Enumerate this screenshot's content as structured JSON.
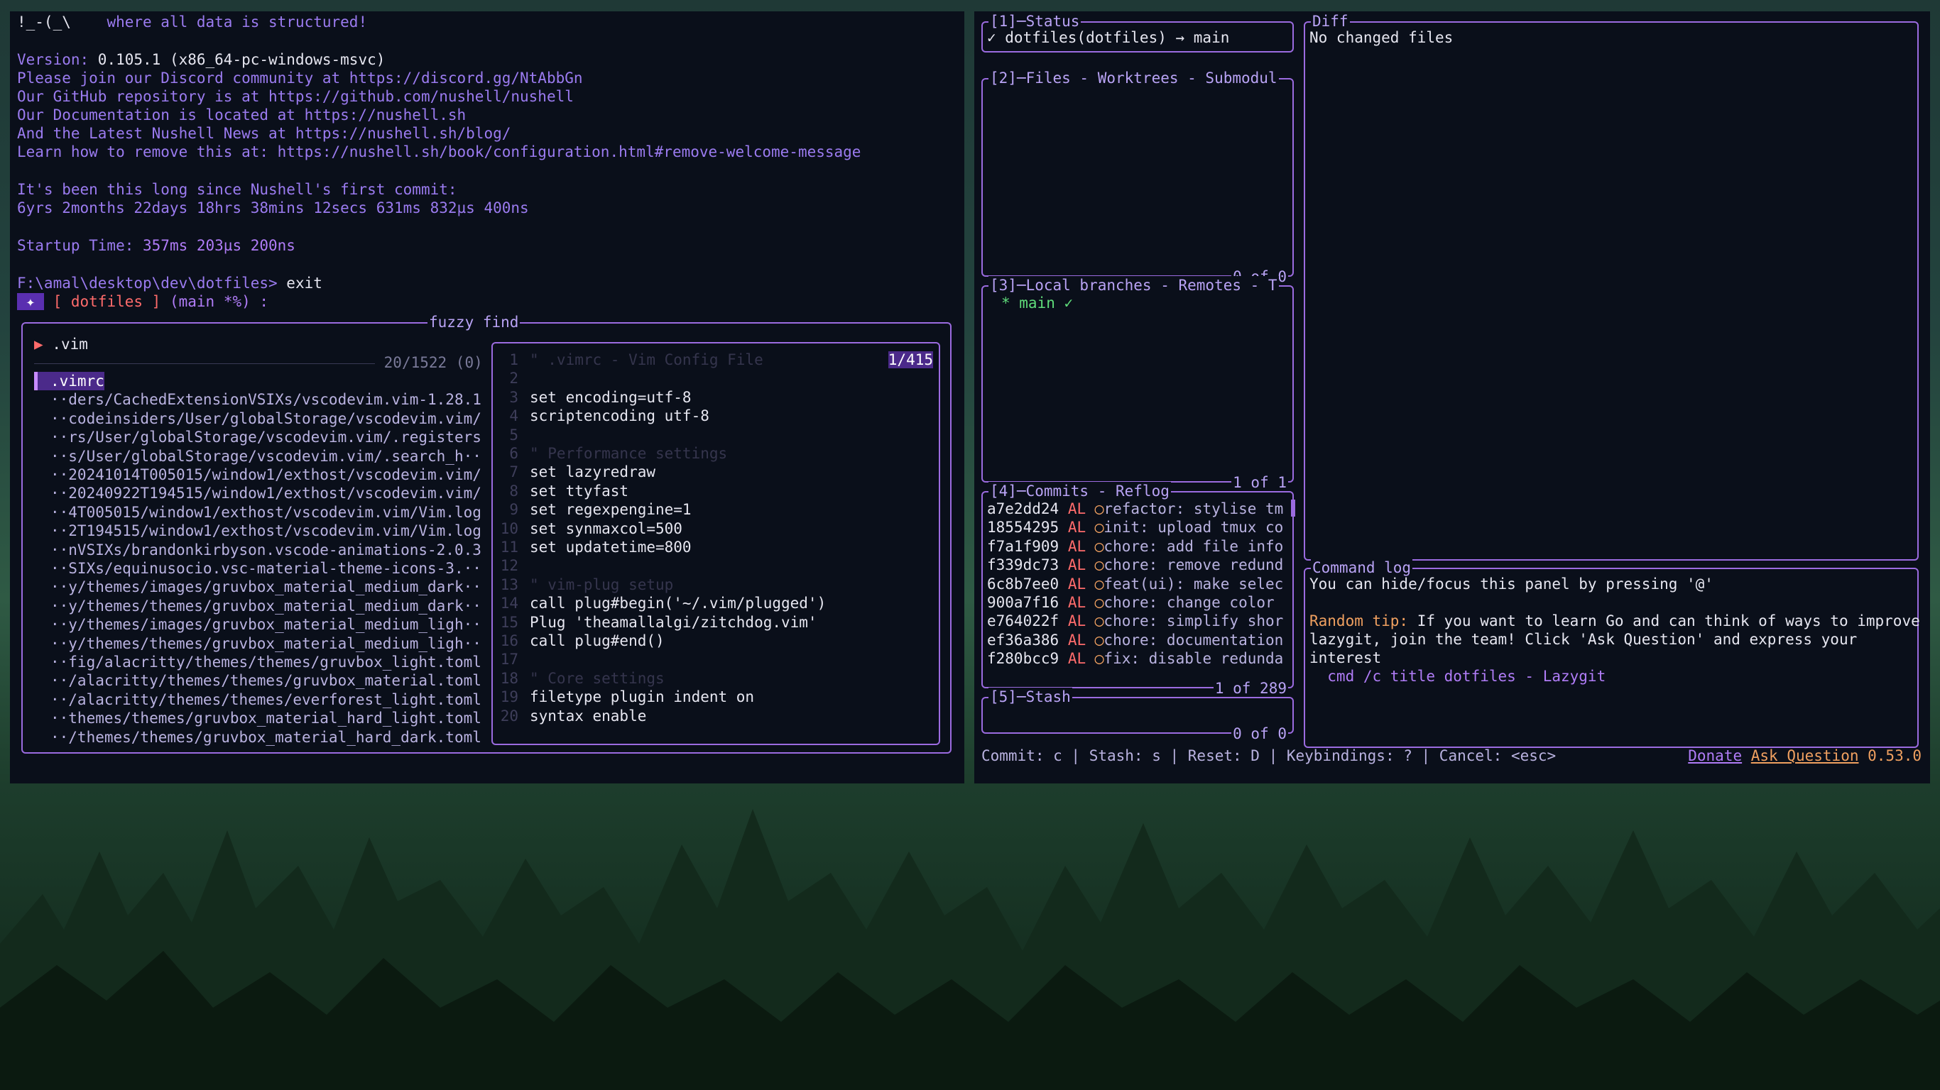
{
  "nushell": {
    "banner_logo": "!_-(_\\",
    "banner_tagline": "where all data is structured!",
    "version_label": "Version: ",
    "version": "0.105.1 (x86_64-pc-windows-msvc)",
    "discord": "Please join our Discord community at https://discord.gg/NtAbbGn",
    "github": "Our GitHub repository is at https://github.com/nushell/nushell",
    "docs": "Our Documentation is located at https://nushell.sh",
    "news": "And the Latest Nushell News at https://nushell.sh/blog/",
    "remove": "Learn how to remove this at: https://nushell.sh/book/configuration.html#remove-welcome-message",
    "since_label": "It's been this long since Nushell's first commit:",
    "since": "6yrs 2months 22days 18hrs 38mins 12secs 631ms 832µs 400ns",
    "startup_label": "Startup Time: ",
    "startup": "357ms 203µs 200ns",
    "prompt_path": "F:\\amal\\desktop\\dev\\dotfiles>",
    "prompt_cmd": " exit",
    "prompt2_icon": " ✦ ",
    "prompt2_repo": " [ dotfiles ]",
    "prompt2_branch": " (main *%) :"
  },
  "fzf": {
    "title": "fuzzy find",
    "query_marker": "▶",
    "query": ".vim",
    "count": "20/1522 (0)",
    "results": [
      ".vimrc",
      "··ders/CachedExtensionVSIXs/vscodevim.vim-1.28.1",
      "··codeinsiders/User/globalStorage/vscodevim.vim/",
      "··rs/User/globalStorage/vscodevim.vim/.registers",
      "··s/User/globalStorage/vscodevim.vim/.search_h··",
      "··20241014T005015/window1/exthost/vscodevim.vim/",
      "··20240922T194515/window1/exthost/vscodevim.vim/",
      "··4T005015/window1/exthost/vscodevim.vim/Vim.log",
      "··2T194515/window1/exthost/vscodevim.vim/Vim.log",
      "··nVSIXs/brandonkirbyson.vscode-animations-2.0.3",
      "··SIXs/equinusocio.vsc-material-theme-icons-3.··",
      "··y/themes/images/gruvbox_material_medium_dark··",
      "··y/themes/themes/gruvbox_material_medium_dark··",
      "··y/themes/images/gruvbox_material_medium_ligh··",
      "··y/themes/themes/gruvbox_material_medium_ligh··",
      "··fig/alacritty/themes/themes/gruvbox_light.toml",
      "··/alacritty/themes/themes/gruvbox_material.toml",
      "··/alacritty/themes/themes/everforest_light.toml",
      "··themes/themes/gruvbox_material_hard_light.toml",
      "··/themes/themes/gruvbox_material_hard_dark.toml"
    ],
    "preview_position": "1/415",
    "preview_lines": [
      {
        "n": "1",
        "text": "\" .vimrc - Vim Config File"
      },
      {
        "n": "2",
        "text": ""
      },
      {
        "n": "3",
        "text": "set encoding=utf-8"
      },
      {
        "n": "4",
        "text": "scriptencoding utf-8"
      },
      {
        "n": "5",
        "text": ""
      },
      {
        "n": "6",
        "text": "\" Performance settings"
      },
      {
        "n": "7",
        "text": "set lazyredraw"
      },
      {
        "n": "8",
        "text": "set ttyfast"
      },
      {
        "n": "9",
        "text": "set regexpengine=1"
      },
      {
        "n": "10",
        "text": "set synmaxcol=500"
      },
      {
        "n": "11",
        "text": "set updatetime=800"
      },
      {
        "n": "12",
        "text": ""
      },
      {
        "n": "13",
        "text": "\" vim-plug setup"
      },
      {
        "n": "14",
        "text": "call plug#begin('~/.vim/plugged')"
      },
      {
        "n": "15",
        "text": "Plug 'theamallalgi/zitchdog.vim'"
      },
      {
        "n": "16",
        "text": "call plug#end()"
      },
      {
        "n": "17",
        "text": ""
      },
      {
        "n": "18",
        "text": "\" Core settings"
      },
      {
        "n": "19",
        "text": "filetype plugin indent on"
      },
      {
        "n": "20",
        "text": "syntax enable"
      }
    ]
  },
  "lazygit": {
    "status_title": "[1]─Status",
    "status_text": "✓ dotfiles(dotfiles) → main",
    "files_title": "[2]─Files - Worktrees - Submodul",
    "files_footer": "0 of 0",
    "branches_title": "[3]─Local branches - Remotes - T",
    "branches_item": "* main ✓",
    "branches_footer": "1 of 1",
    "commits_title": "[4]─Commits - Reflog",
    "commits": [
      {
        "hash": "a7e2dd24",
        "author": "AL",
        "msg": "refactor: stylise tm"
      },
      {
        "hash": "18554295",
        "author": "AL",
        "msg": "init: upload tmux co"
      },
      {
        "hash": "f7a1f909",
        "author": "AL",
        "msg": "chore: add file info"
      },
      {
        "hash": "f339dc73",
        "author": "AL",
        "msg": "chore: remove redund"
      },
      {
        "hash": "6c8b7ee0",
        "author": "AL",
        "msg": "feat(ui): make selec"
      },
      {
        "hash": "900a7f16",
        "author": "AL",
        "msg": "chore: change color"
      },
      {
        "hash": "e764022f",
        "author": "AL",
        "msg": "chore: simplify shor"
      },
      {
        "hash": "ef36a386",
        "author": "AL",
        "msg": "chore: documentation"
      },
      {
        "hash": "f280bcc9",
        "author": "AL",
        "msg": "fix: disable redunda"
      }
    ],
    "commits_footer": "1 of 289",
    "stash_title": "[5]─Stash",
    "stash_footer": "0 of 0",
    "diff_title": "Diff",
    "diff_text": "No changed files",
    "cmdlog_title": "Command log",
    "cmdlog_line1": "You can hide/focus this panel by pressing '@'",
    "tip_label": "Random tip:",
    "tip_text1": " If you want to learn Go and can think of ways to improve",
    "tip_text2": "lazygit, join the team! Click 'Ask Question' and express your",
    "tip_text3": "interest",
    "cmdlog_cmd": "  cmd /c title dotfiles - Lazygit",
    "statusbar": "Commit: c | Stash: s | Reset: D | Keybindings: ? | Cancel: <esc>",
    "donate": "Donate",
    "ask": "Ask Question",
    "version": "0.53.0"
  }
}
